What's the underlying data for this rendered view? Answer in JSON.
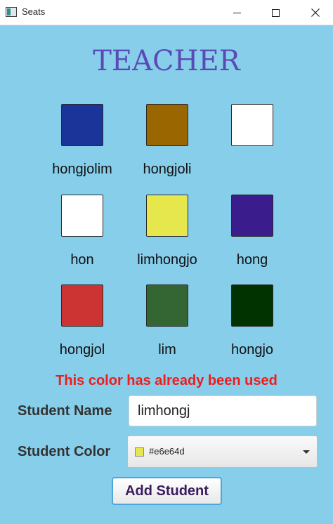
{
  "window": {
    "title": "Seats",
    "icon": "app-window-icon",
    "controls": [
      "minimize-icon",
      "maximize-icon",
      "close-icon"
    ]
  },
  "header": {
    "title": "TEACHER"
  },
  "seats": [
    {
      "name": "hongjolim",
      "color": "#1a3499"
    },
    {
      "name": "hongjoli",
      "color": "#9a6600"
    },
    {
      "name": "",
      "color": "#ffffff"
    },
    {
      "name": "hon",
      "color": "#ffffff"
    },
    {
      "name": "limhongjo",
      "color": "#e6e64d"
    },
    {
      "name": "hong",
      "color": "#3a1c8c"
    },
    {
      "name": "hongjol",
      "color": "#cc3333"
    },
    {
      "name": "lim",
      "color": "#336633"
    },
    {
      "name": "hongjo",
      "color": "#003300"
    }
  ],
  "form": {
    "error": "This color has already been used",
    "name_label": "Student Name",
    "name_value": "limhongj",
    "color_label": "Student Color",
    "color_value": "#e6e64d",
    "submit_label": "Add Student"
  }
}
